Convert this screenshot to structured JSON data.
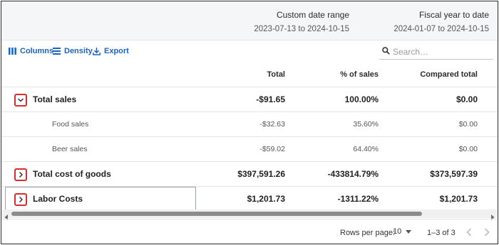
{
  "date_header": {
    "columns": [
      {
        "title": "Custom date range",
        "range": "2023-07-13 to 2024-10-15"
      },
      {
        "title": "Fiscal year to date",
        "range": "2024-01-07 to 2024-10-15"
      }
    ]
  },
  "toolbar": {
    "columns_label": "Columns",
    "density_label": "Density",
    "export_label": "Export",
    "search_placeholder": "Search…",
    "accent_color": "#1a63c2"
  },
  "table": {
    "headers": {
      "total": "Total",
      "pct": "% of sales",
      "compared": "Compared total"
    },
    "rows": [
      {
        "type": "parent",
        "label": "Total sales",
        "expanded": true,
        "total": "-$91.65",
        "pct": "100.00%",
        "compared": "$0.00"
      },
      {
        "type": "child",
        "label": "Food sales",
        "total": "-$32.63",
        "pct": "35.60%",
        "compared": "$0.00"
      },
      {
        "type": "child",
        "label": "Beer sales",
        "total": "-$59.02",
        "pct": "64.40%",
        "compared": "$0.00"
      },
      {
        "type": "parent",
        "label": "Total cost of goods",
        "expanded": false,
        "total": "$397,591.26",
        "pct": "-433814.79%",
        "compared": "$373,597.39"
      },
      {
        "type": "parent",
        "label": "Labor Costs",
        "expanded": false,
        "total": "$1,201.73",
        "pct": "-1311.22%",
        "compared": "$1,201.73"
      }
    ],
    "highlight_color": "#d92c2c"
  },
  "footer": {
    "rows_per_page_label": "Rows per page:",
    "rows_per_page_value": "10",
    "range_text": "1–3 of 3"
  }
}
